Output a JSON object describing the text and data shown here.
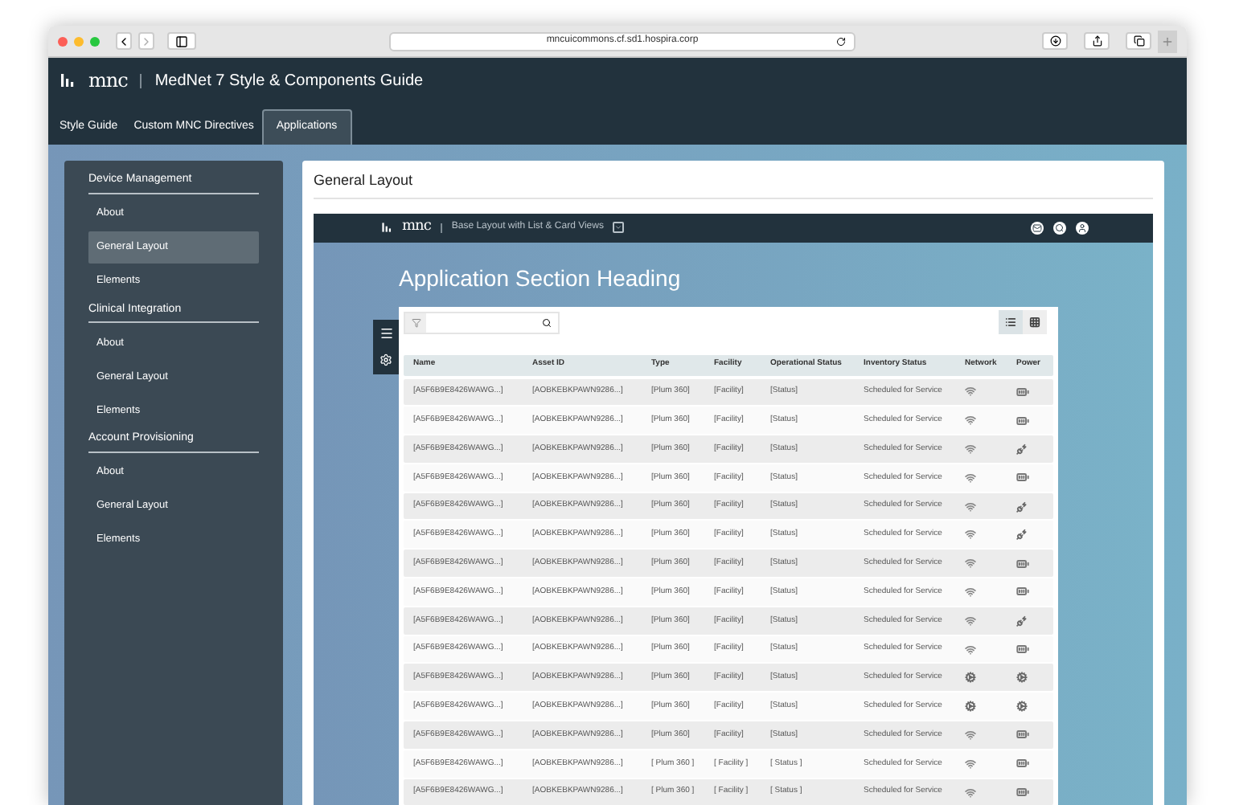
{
  "browser": {
    "url": "mncuicommons.cf.sd1.hospira.corp"
  },
  "app": {
    "logo": "mnc",
    "title": "MedNet 7 Style & Components Guide"
  },
  "tabs": [
    {
      "label": "Style Guide",
      "selected": false
    },
    {
      "label": "Custom MNC Directives",
      "selected": false
    },
    {
      "label": "Applications",
      "selected": true
    }
  ],
  "sidebar": {
    "sections": [
      {
        "title": "Device Management",
        "items": [
          {
            "label": "About",
            "selected": false
          },
          {
            "label": "General Layout",
            "selected": true
          },
          {
            "label": "Elements",
            "selected": false
          }
        ]
      },
      {
        "title": "Clinical Integration",
        "items": [
          {
            "label": "About",
            "selected": false
          },
          {
            "label": "General Layout",
            "selected": false
          },
          {
            "label": "Elements",
            "selected": false
          }
        ]
      },
      {
        "title": "Account Provisioning",
        "items": [
          {
            "label": "About",
            "selected": false
          },
          {
            "label": "General Layout",
            "selected": false
          },
          {
            "label": "Elements",
            "selected": false
          }
        ]
      }
    ]
  },
  "content": {
    "title": "General Layout",
    "demo": {
      "logo": "mnc",
      "title": "Base Layout with List & Card Views",
      "heading": "Application Section Heading",
      "view_toggle": [
        {
          "kind": "list",
          "selected": true
        },
        {
          "kind": "grid",
          "selected": false
        }
      ],
      "table": {
        "columns": [
          "Name",
          "Asset ID",
          "Type",
          "Facility",
          "Operational Status",
          "Inventory Status",
          "Network",
          "Power"
        ],
        "rows": [
          {
            "cells": [
              "[A5F6B9E8426WAWG...]",
              "[AOBKEBKPAWN9286...]",
              "[Plum 360]",
              "[Facility]",
              "[Status]",
              "Scheduled for Service"
            ],
            "network": {
              "kind": "wifi"
            },
            "power": {
              "kind": "battery"
            }
          },
          {
            "cells": [
              "[A5F6B9E8426WAWG...]",
              "[AOBKEBKPAWN9286...]",
              "[Plum 360]",
              "[Facility]",
              "[Status]",
              "Scheduled for Service"
            ],
            "network": {
              "kind": "wifi"
            },
            "power": {
              "kind": "battery"
            }
          },
          {
            "cells": [
              "[A5F6B9E8426WAWG...]",
              "[AOBKEBKPAWN9286...]",
              "[Plum 360]",
              "[Facility]",
              "[Status]",
              "Scheduled for Service"
            ],
            "network": {
              "kind": "wifi"
            },
            "power": {
              "kind": "plugged"
            }
          },
          {
            "cells": [
              "[A5F6B9E8426WAWG...]",
              "[AOBKEBKPAWN9286...]",
              "[Plum 360]",
              "[Facility]",
              "[Status]",
              "Scheduled for Service"
            ],
            "network": {
              "kind": "wifi"
            },
            "power": {
              "kind": "battery"
            }
          },
          {
            "cells": [
              "[A5F6B9E8426WAWG...]",
              "[AOBKEBKPAWN9286...]",
              "[Plum 360]",
              "[Facility]",
              "[Status]",
              "Scheduled for Service"
            ],
            "network": {
              "kind": "wifi"
            },
            "power": {
              "kind": "plugged"
            }
          },
          {
            "cells": [
              "[A5F6B9E8426WAWG...]",
              "[AOBKEBKPAWN9286...]",
              "[Plum 360]",
              "[Facility]",
              "[Status]",
              "Scheduled for Service"
            ],
            "network": {
              "kind": "wifi"
            },
            "power": {
              "kind": "plugged"
            }
          },
          {
            "cells": [
              "[A5F6B9E8426WAWG...]",
              "[AOBKEBKPAWN9286...]",
              "[Plum 360]",
              "[Facility]",
              "[Status]",
              "Scheduled for Service"
            ],
            "network": {
              "kind": "wifi"
            },
            "power": {
              "kind": "battery"
            }
          },
          {
            "cells": [
              "[A5F6B9E8426WAWG...]",
              "[AOBKEBKPAWN9286...]",
              "[Plum 360]",
              "[Facility]",
              "[Status]",
              "Scheduled for Service"
            ],
            "network": {
              "kind": "wifi"
            },
            "power": {
              "kind": "battery"
            }
          },
          {
            "cells": [
              "[A5F6B9E8426WAWG...]",
              "[AOBKEBKPAWN9286...]",
              "[Plum 360]",
              "[Facility]",
              "[Status]",
              "Scheduled for Service"
            ],
            "network": {
              "kind": "wifi"
            },
            "power": {
              "kind": "plugged"
            }
          },
          {
            "cells": [
              "[A5F6B9E8426WAWG...]",
              "[AOBKEBKPAWN9286...]",
              "[Plum 360]",
              "[Facility]",
              "[Status]",
              "Scheduled for Service"
            ],
            "network": {
              "kind": "wifi"
            },
            "power": {
              "kind": "battery"
            }
          },
          {
            "cells": [
              "[A5F6B9E8426WAWG...]",
              "[AOBKEBKPAWN9286...]",
              "[Plum 360]",
              "[Facility]",
              "[Status]",
              "Scheduled for Service"
            ],
            "network": {
              "kind": "offline"
            },
            "power": {
              "kind": "offline"
            }
          },
          {
            "cells": [
              "[A5F6B9E8426WAWG...]",
              "[AOBKEBKPAWN9286...]",
              "[Plum 360]",
              "[Facility]",
              "[Status]",
              "Scheduled for Service"
            ],
            "network": {
              "kind": "offline"
            },
            "power": {
              "kind": "offline"
            }
          },
          {
            "cells": [
              "[A5F6B9E8426WAWG...]",
              "[AOBKEBKPAWN9286...]",
              "[Plum 360]",
              "[Facility]",
              "[Status]",
              "Scheduled for Service"
            ],
            "network": {
              "kind": "wifi"
            },
            "power": {
              "kind": "battery"
            }
          },
          {
            "cells": [
              "[A5F6B9E8426WAWG...]",
              "[AOBKEBKPAWN9286...]",
              "[ Plum 360 ]",
              "[ Facility ]",
              "[ Status ]",
              "Scheduled for Service"
            ],
            "network": {
              "kind": "wifi"
            },
            "power": {
              "kind": "battery"
            }
          },
          {
            "cells": [
              "[A5F6B9E8426WAWG...]",
              "[AOBKEBKPAWN9286...]",
              "[ Plum 360 ]",
              "[ Facility ]",
              "[ Status ]",
              "Scheduled for Service"
            ],
            "network": {
              "kind": "wifi"
            },
            "power": {
              "kind": "battery"
            }
          }
        ]
      }
    }
  }
}
